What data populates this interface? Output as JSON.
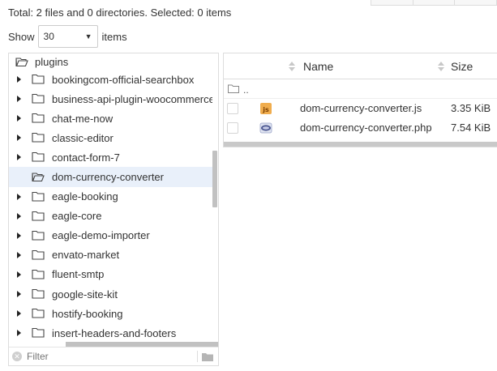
{
  "summary": "Total: 2 files and 0 directories. Selected: 0 items",
  "paging": {
    "show_label": "Show",
    "per_page": "30",
    "items_label": "items"
  },
  "tree": {
    "root": "plugins",
    "items": [
      {
        "label": "bookingcom-official-searchbox",
        "selected": false
      },
      {
        "label": "business-api-plugin-woocommerce",
        "selected": false
      },
      {
        "label": "chat-me-now",
        "selected": false
      },
      {
        "label": "classic-editor",
        "selected": false
      },
      {
        "label": "contact-form-7",
        "selected": false
      },
      {
        "label": "dom-currency-converter",
        "selected": true
      },
      {
        "label": "eagle-booking",
        "selected": false
      },
      {
        "label": "eagle-core",
        "selected": false
      },
      {
        "label": "eagle-demo-importer",
        "selected": false
      },
      {
        "label": "envato-market",
        "selected": false
      },
      {
        "label": "fluent-smtp",
        "selected": false
      },
      {
        "label": "google-site-kit",
        "selected": false
      },
      {
        "label": "hostify-booking",
        "selected": false
      },
      {
        "label": "insert-headers-and-footers",
        "selected": false
      }
    ],
    "filter_placeholder": "Filter"
  },
  "files": {
    "columns": {
      "name": "Name",
      "size": "Size"
    },
    "parent_label": "..",
    "rows": [
      {
        "name": "dom-currency-converter.js",
        "size": "3.35 KiB",
        "icon": "js-file-icon"
      },
      {
        "name": "dom-currency-converter.php",
        "size": "7.54 KiB",
        "icon": "php-file-icon"
      }
    ]
  },
  "colors": {
    "selected_row": "#e9f0fa",
    "border": "#dddddd",
    "js_icon": "#f0ad4e",
    "php_icon": "#4f5b93"
  }
}
